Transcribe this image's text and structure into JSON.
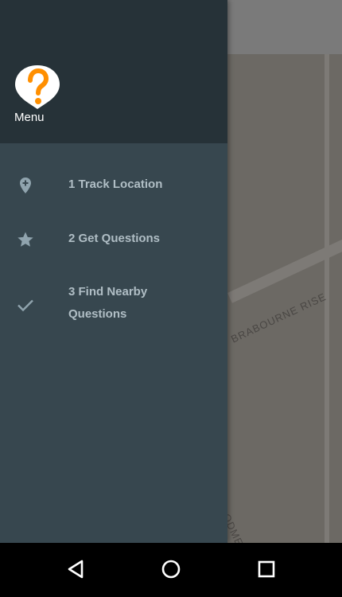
{
  "drawer": {
    "header": {
      "title": "Menu",
      "logo_icon": "question-mark-marker-icon",
      "logo_color": "#ff8f00"
    },
    "items": [
      {
        "label": "1 Track Location",
        "icon": "add-location-icon"
      },
      {
        "label": "2 Get Questions",
        "icon": "star-icon"
      },
      {
        "label": "3 Find Nearby Questions",
        "icon": "check-icon"
      }
    ],
    "colors": {
      "header_bg": "#263238",
      "body_bg": "#37474f",
      "item_text": "#b0bec5"
    }
  },
  "map": {
    "street_labels": [
      "BRABOURNE RISE",
      "OODME"
    ]
  },
  "system_nav": {
    "buttons": [
      "back-icon",
      "home-icon",
      "recents-icon"
    ]
  }
}
